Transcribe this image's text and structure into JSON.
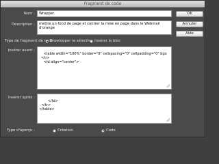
{
  "window": {
    "title": "Fragment de code"
  },
  "form": {
    "name_label": "Nom :",
    "name_value": "Wrapper",
    "description_label": "Description :",
    "description_value": "mettre un fond de page et centrer la mise en page dans le Webmail d'orange",
    "type_label": "Type de fragment de code :",
    "type_options": [
      {
        "label": "Envelopper la sélection",
        "selected": true
      },
      {
        "label": "Insérer le bloc",
        "selected": false
      }
    ],
    "before_label": "Insérer avant :",
    "before_code": "<table width=\"100%\" border=\"0\" cellspacing=\"0\" cellpadding=\"0\" bgo\n  <tr>\n    <td align=\"center\">",
    "after_label": "Insérer après :",
    "after_code": "    </td>\n  </tr>\n</table>",
    "preview_label": "Type d'aperçu :",
    "preview_options": [
      {
        "label": "Création",
        "selected": false
      },
      {
        "label": "Code",
        "selected": true
      }
    ]
  },
  "buttons": {
    "ok": "OK",
    "cancel": "Annuler",
    "help": "Aide"
  }
}
